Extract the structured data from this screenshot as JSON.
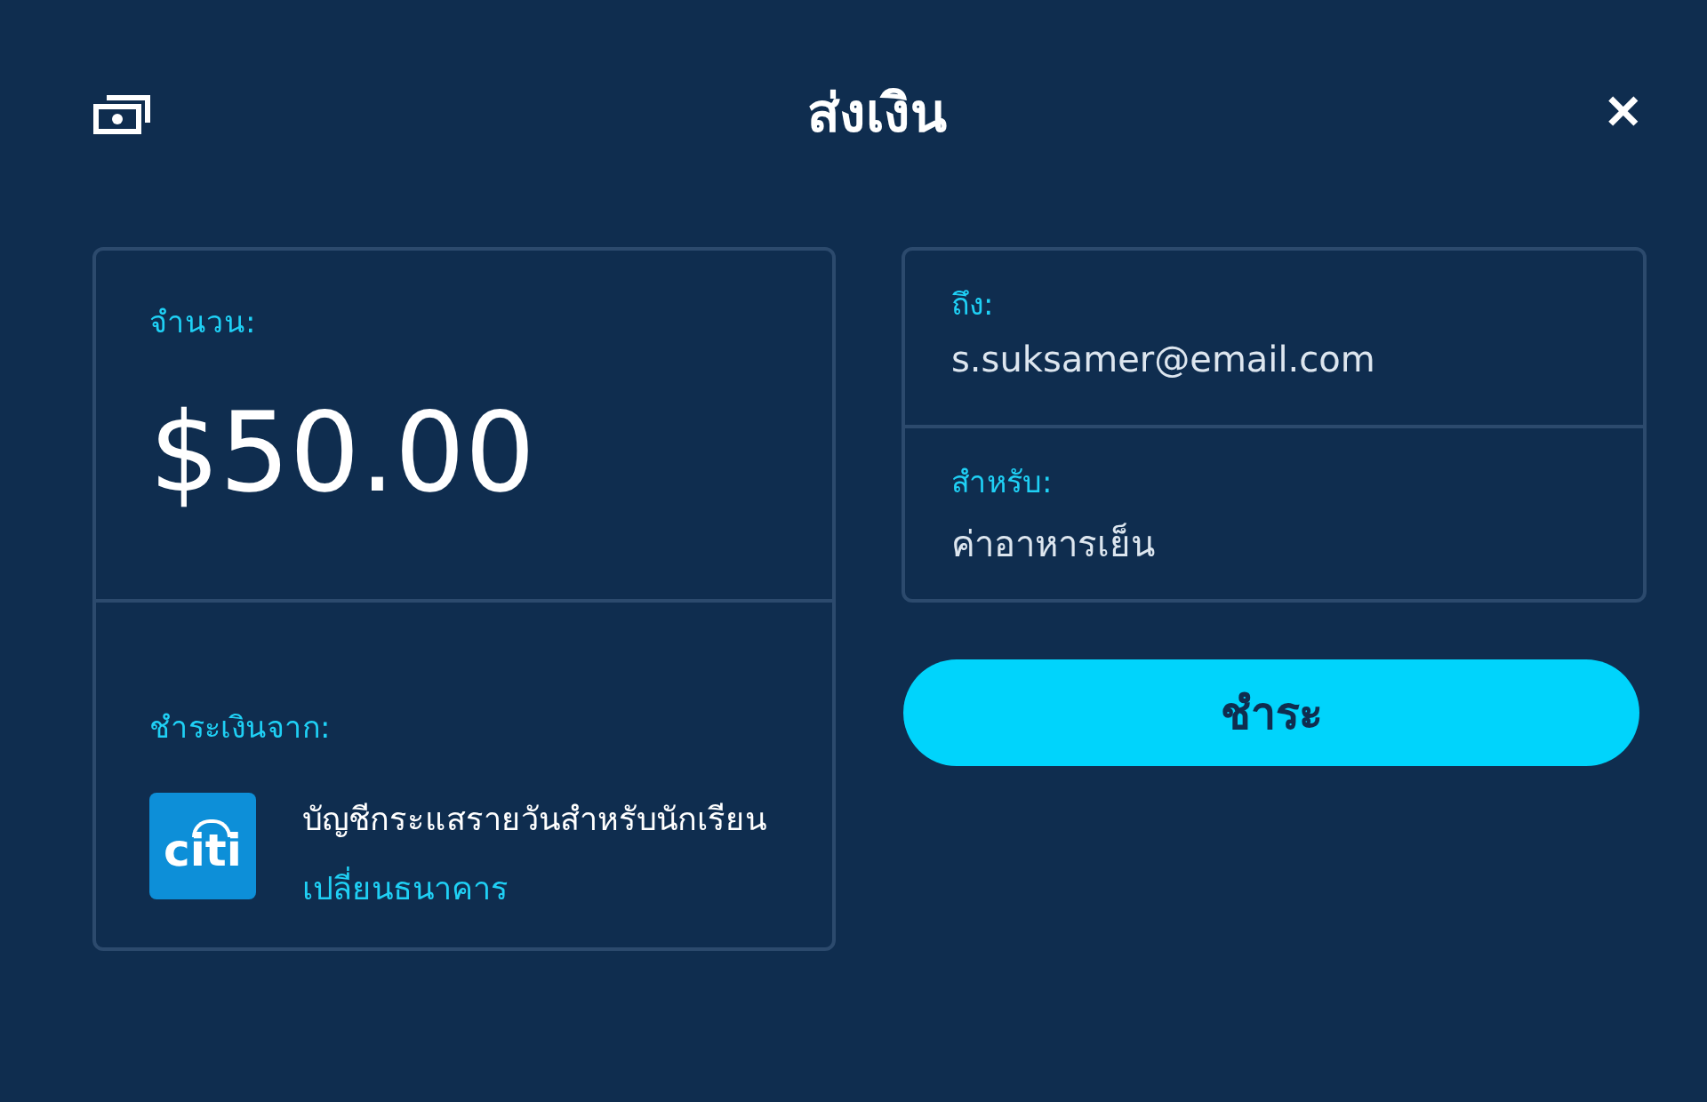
{
  "header": {
    "title": "ส่งเงิน",
    "close": "✕"
  },
  "amount": {
    "label": "จำนวน:",
    "value": "$50.00"
  },
  "source": {
    "label": "ชำระเงินจาก:",
    "bank_logo": "citi",
    "account": "บัญชีกระแสรายวันสำหรับนักเรียน",
    "change_link": "เปลี่ยนธนาคาร"
  },
  "recipient": {
    "to_label": "ถึง:",
    "to_value": "s.suksamer@email.com",
    "for_label": "สำหรับ:",
    "for_value": "ค่าอาหารเย็น"
  },
  "pay_button": "ชำระ"
}
